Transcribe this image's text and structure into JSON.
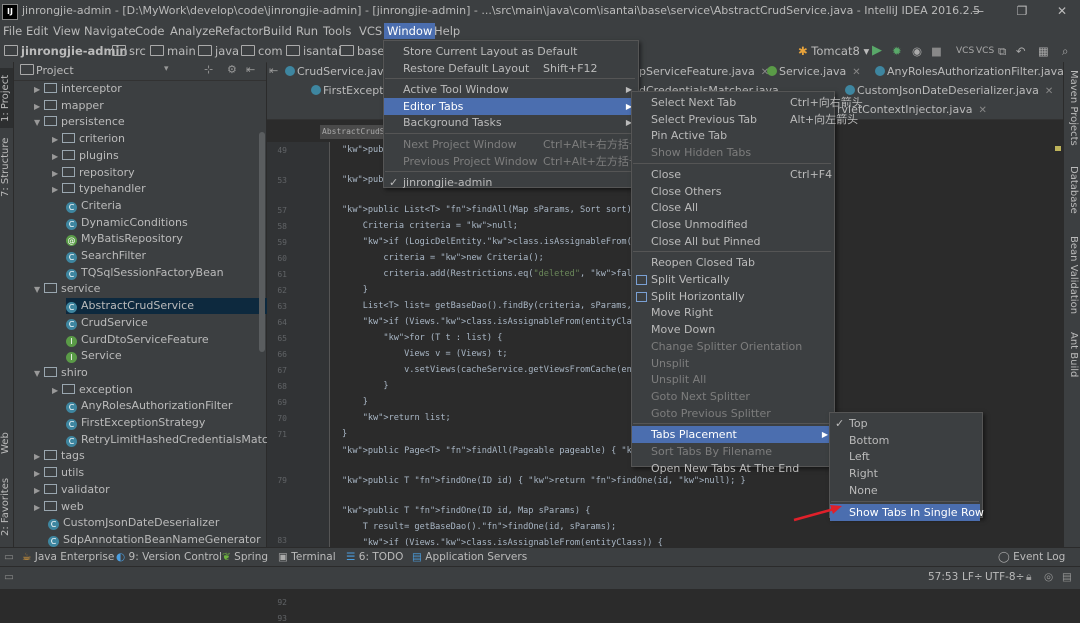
{
  "window": {
    "title": "jinrongjie-admin - [D:\\MyWork\\develop\\code\\jinrongjie-admin] - [jinrongjie-admin] - ...\\src\\main\\java\\com\\isantai\\base\\service\\AbstractCrudService.java - IntelliJ IDEA 2016.2.5",
    "app_icon": "IJ",
    "min": "—",
    "max": "❐",
    "close": "✕"
  },
  "menubar": [
    "File",
    "Edit",
    "View",
    "Navigate",
    "Code",
    "Analyze",
    "Refactor",
    "Build",
    "Run",
    "Tools",
    "VCS",
    "Window",
    "Help"
  ],
  "navbar": {
    "crumbs": [
      "jinrongjie-admin",
      "src",
      "main",
      "java",
      "com",
      "isantai",
      "base"
    ],
    "run_config": "Tomcat8"
  },
  "project_panel": {
    "title": "Project",
    "items": [
      {
        "label": "interceptor",
        "kind": "folder",
        "arrow": "▶"
      },
      {
        "label": "mapper",
        "kind": "folder",
        "arrow": "▶"
      },
      {
        "label": "persistence",
        "kind": "folder",
        "arrow": "▼"
      },
      {
        "label": "criterion",
        "kind": "folder",
        "arrow": "▶"
      },
      {
        "label": "plugins",
        "kind": "folder",
        "arrow": "▶"
      },
      {
        "label": "repository",
        "kind": "folder",
        "arrow": "▶"
      },
      {
        "label": "typehandler",
        "kind": "folder",
        "arrow": "▶"
      },
      {
        "label": "Criteria",
        "kind": "class",
        "arrow": ""
      },
      {
        "label": "DynamicConditions",
        "kind": "class",
        "arrow": ""
      },
      {
        "label": "MyBatisRepository",
        "kind": "annotation",
        "arrow": ""
      },
      {
        "label": "SearchFilter",
        "kind": "class",
        "arrow": ""
      },
      {
        "label": "TQSqlSessionFactoryBean",
        "kind": "class",
        "arrow": ""
      },
      {
        "label": "service",
        "kind": "folder",
        "arrow": "▼"
      },
      {
        "label": "AbstractCrudService",
        "kind": "class",
        "arrow": ""
      },
      {
        "label": "CrudService",
        "kind": "class",
        "arrow": ""
      },
      {
        "label": "CurdDtoServiceFeature",
        "kind": "interface",
        "arrow": ""
      },
      {
        "label": "Service",
        "kind": "interface",
        "arrow": ""
      },
      {
        "label": "shiro",
        "kind": "folder",
        "arrow": "▼"
      },
      {
        "label": "exception",
        "kind": "folder",
        "arrow": "▶"
      },
      {
        "label": "AnyRolesAuthorizationFilter",
        "kind": "class",
        "arrow": ""
      },
      {
        "label": "FirstExceptionStrategy",
        "kind": "class",
        "arrow": ""
      },
      {
        "label": "RetryLimitHashedCredentialsMatcher",
        "kind": "class",
        "arrow": ""
      },
      {
        "label": "tags",
        "kind": "folder",
        "arrow": "▶"
      },
      {
        "label": "utils",
        "kind": "folder",
        "arrow": "▶"
      },
      {
        "label": "validator",
        "kind": "folder",
        "arrow": "▶"
      },
      {
        "label": "web",
        "kind": "folder",
        "arrow": "▶"
      },
      {
        "label": "CustomJsonDateDeserializer",
        "kind": "class",
        "arrow": ""
      },
      {
        "label": "SdpAnnotationBeanNameGenerator",
        "kind": "class",
        "arrow": ""
      }
    ]
  },
  "editor_tabs_row1": [
    "CrudService.java",
    "pServiceFeature.java",
    "Service.java",
    "AnyRolesAuthorizationFilter.java"
  ],
  "editor_tabs_row2": [
    "FirstExceptio",
    "dCredentialsMatcher.java",
    "CustomJsonDateDeserializer.java"
  ],
  "editor_tabs_row3": [
    "rvletContextInjector.java"
  ],
  "breadcrumb_tag": "AbstractCrudS",
  "line_numbers": [
    "49",
    "53",
    "57",
    "58",
    "59",
    "60",
    "61",
    "62",
    "63",
    "64",
    "65",
    "66",
    "67",
    "68",
    "69",
    "70",
    "71",
    "",
    "79",
    "",
    "83",
    "",
    "91",
    "92",
    "93"
  ],
  "code_lines": [
    "public Cr",
    "public Li",
    "public List<T> findAll(Map sParams, Sort sort) {",
    "    Criteria criteria = null;",
    "    if (LogicDelEntity.class.isAssignableFrom(entityClass))",
    "        criteria = new Criteria();",
    "        criteria.add(Restrictions.eq(\"deleted\", false));",
    "    }",
    "    List<T> list= getBaseDao().findBy(criteria, sParams, sort",
    "    if (Views.class.isAssignableFrom(entityClass)) {",
    "        for (T t : list) {",
    "            Views v = (Views) t;",
    "            v.setViews(cacheService.getViewsFromCache(entityC",
    "        }",
    "    }",
    "    return list;",
    "}",
    "public Page<T> findAll(Pageable pageable) { return findAll((",
    "public T findOne(ID id) { return findOne(id, null); }",
    "public T findOne(ID id, Map sParams) {",
    "    T result= getBaseDao().findOne(id, sParams);",
    "    if (Views.class.isAssignableFrom(entityClass)) {"
  ],
  "window_menu": [
    {
      "label": "Store Current Layout as Default",
      "shortcut": "",
      "disabled": false
    },
    {
      "label": "Restore Default Layout",
      "shortcut": "Shift+F12",
      "disabled": false
    },
    {
      "label": "Active Tool Window",
      "shortcut": "",
      "disabled": false,
      "submenu": true
    },
    {
      "label": "Editor Tabs",
      "shortcut": "",
      "disabled": false,
      "submenu": true,
      "highlight": true
    },
    {
      "label": "Background Tasks",
      "shortcut": "",
      "disabled": false,
      "submenu": true
    },
    {
      "label": "Next Project Window",
      "shortcut": "Ctrl+Alt+右方括号",
      "disabled": true
    },
    {
      "label": "Previous Project Window",
      "shortcut": "Ctrl+Alt+左方括号",
      "disabled": true
    },
    {
      "label": "jinrongjie-admin",
      "shortcut": "",
      "disabled": false,
      "check": true
    }
  ],
  "editor_tabs_menu": [
    {
      "label": "Select Next Tab",
      "shortcut": "Ctrl+向右箭头",
      "disabled": false
    },
    {
      "label": "Select Previous Tab",
      "shortcut": "Alt+向左箭头",
      "disabled": false
    },
    {
      "label": "Pin Active Tab",
      "shortcut": "",
      "disabled": false
    },
    {
      "label": "Show Hidden Tabs",
      "shortcut": "",
      "disabled": true
    },
    {
      "label": "Close",
      "shortcut": "Ctrl+F4",
      "disabled": false
    },
    {
      "label": "Close Others",
      "shortcut": "",
      "disabled": false
    },
    {
      "label": "Close All",
      "shortcut": "",
      "disabled": false
    },
    {
      "label": "Close Unmodified",
      "shortcut": "",
      "disabled": false
    },
    {
      "label": "Close All but Pinned",
      "shortcut": "",
      "disabled": false
    },
    {
      "label": "Reopen Closed Tab",
      "shortcut": "",
      "disabled": false
    },
    {
      "label": "Split Vertically",
      "shortcut": "",
      "disabled": false
    },
    {
      "label": "Split Horizontally",
      "shortcut": "",
      "disabled": false
    },
    {
      "label": "Move Right",
      "shortcut": "",
      "disabled": false
    },
    {
      "label": "Move Down",
      "shortcut": "",
      "disabled": false
    },
    {
      "label": "Change Splitter Orientation",
      "shortcut": "",
      "disabled": true
    },
    {
      "label": "Unsplit",
      "shortcut": "",
      "disabled": true
    },
    {
      "label": "Unsplit All",
      "shortcut": "",
      "disabled": true
    },
    {
      "label": "Goto Next Splitter",
      "shortcut": "",
      "disabled": true
    },
    {
      "label": "Goto Previous Splitter",
      "shortcut": "",
      "disabled": true
    },
    {
      "label": "Tabs Placement",
      "shortcut": "",
      "disabled": false,
      "highlight": true,
      "submenu": true
    },
    {
      "label": "Sort Tabs By Filename",
      "shortcut": "",
      "disabled": true
    },
    {
      "label": "Open New Tabs At The End",
      "shortcut": "",
      "disabled": false
    }
  ],
  "tabs_placement_menu": [
    {
      "label": "Top",
      "check": true
    },
    {
      "label": "Bottom"
    },
    {
      "label": "Left"
    },
    {
      "label": "Right"
    },
    {
      "label": "None"
    },
    {
      "label": "Show Tabs In Single Row",
      "highlight": true
    }
  ],
  "left_vtabs": [
    "1: Project",
    "7: Structure",
    "Web",
    "2: Favorites"
  ],
  "right_vtabs": [
    "Maven Projects",
    "Database",
    "Bean Validation",
    "Ant Build"
  ],
  "bottom_tabs": [
    "Java Enterprise",
    "9: Version Control",
    "Spring",
    "Terminal",
    "6: TODO",
    "Application Servers"
  ],
  "event_log": "Event Log",
  "status": {
    "position": "57:53",
    "line_sep": "LF÷",
    "encoding": "UTF-8÷"
  },
  "colors": {
    "accent": "#4b6eaf",
    "bg": "#2b2b2b",
    "panel": "#3c3f41",
    "arrow": "#e0202a"
  }
}
